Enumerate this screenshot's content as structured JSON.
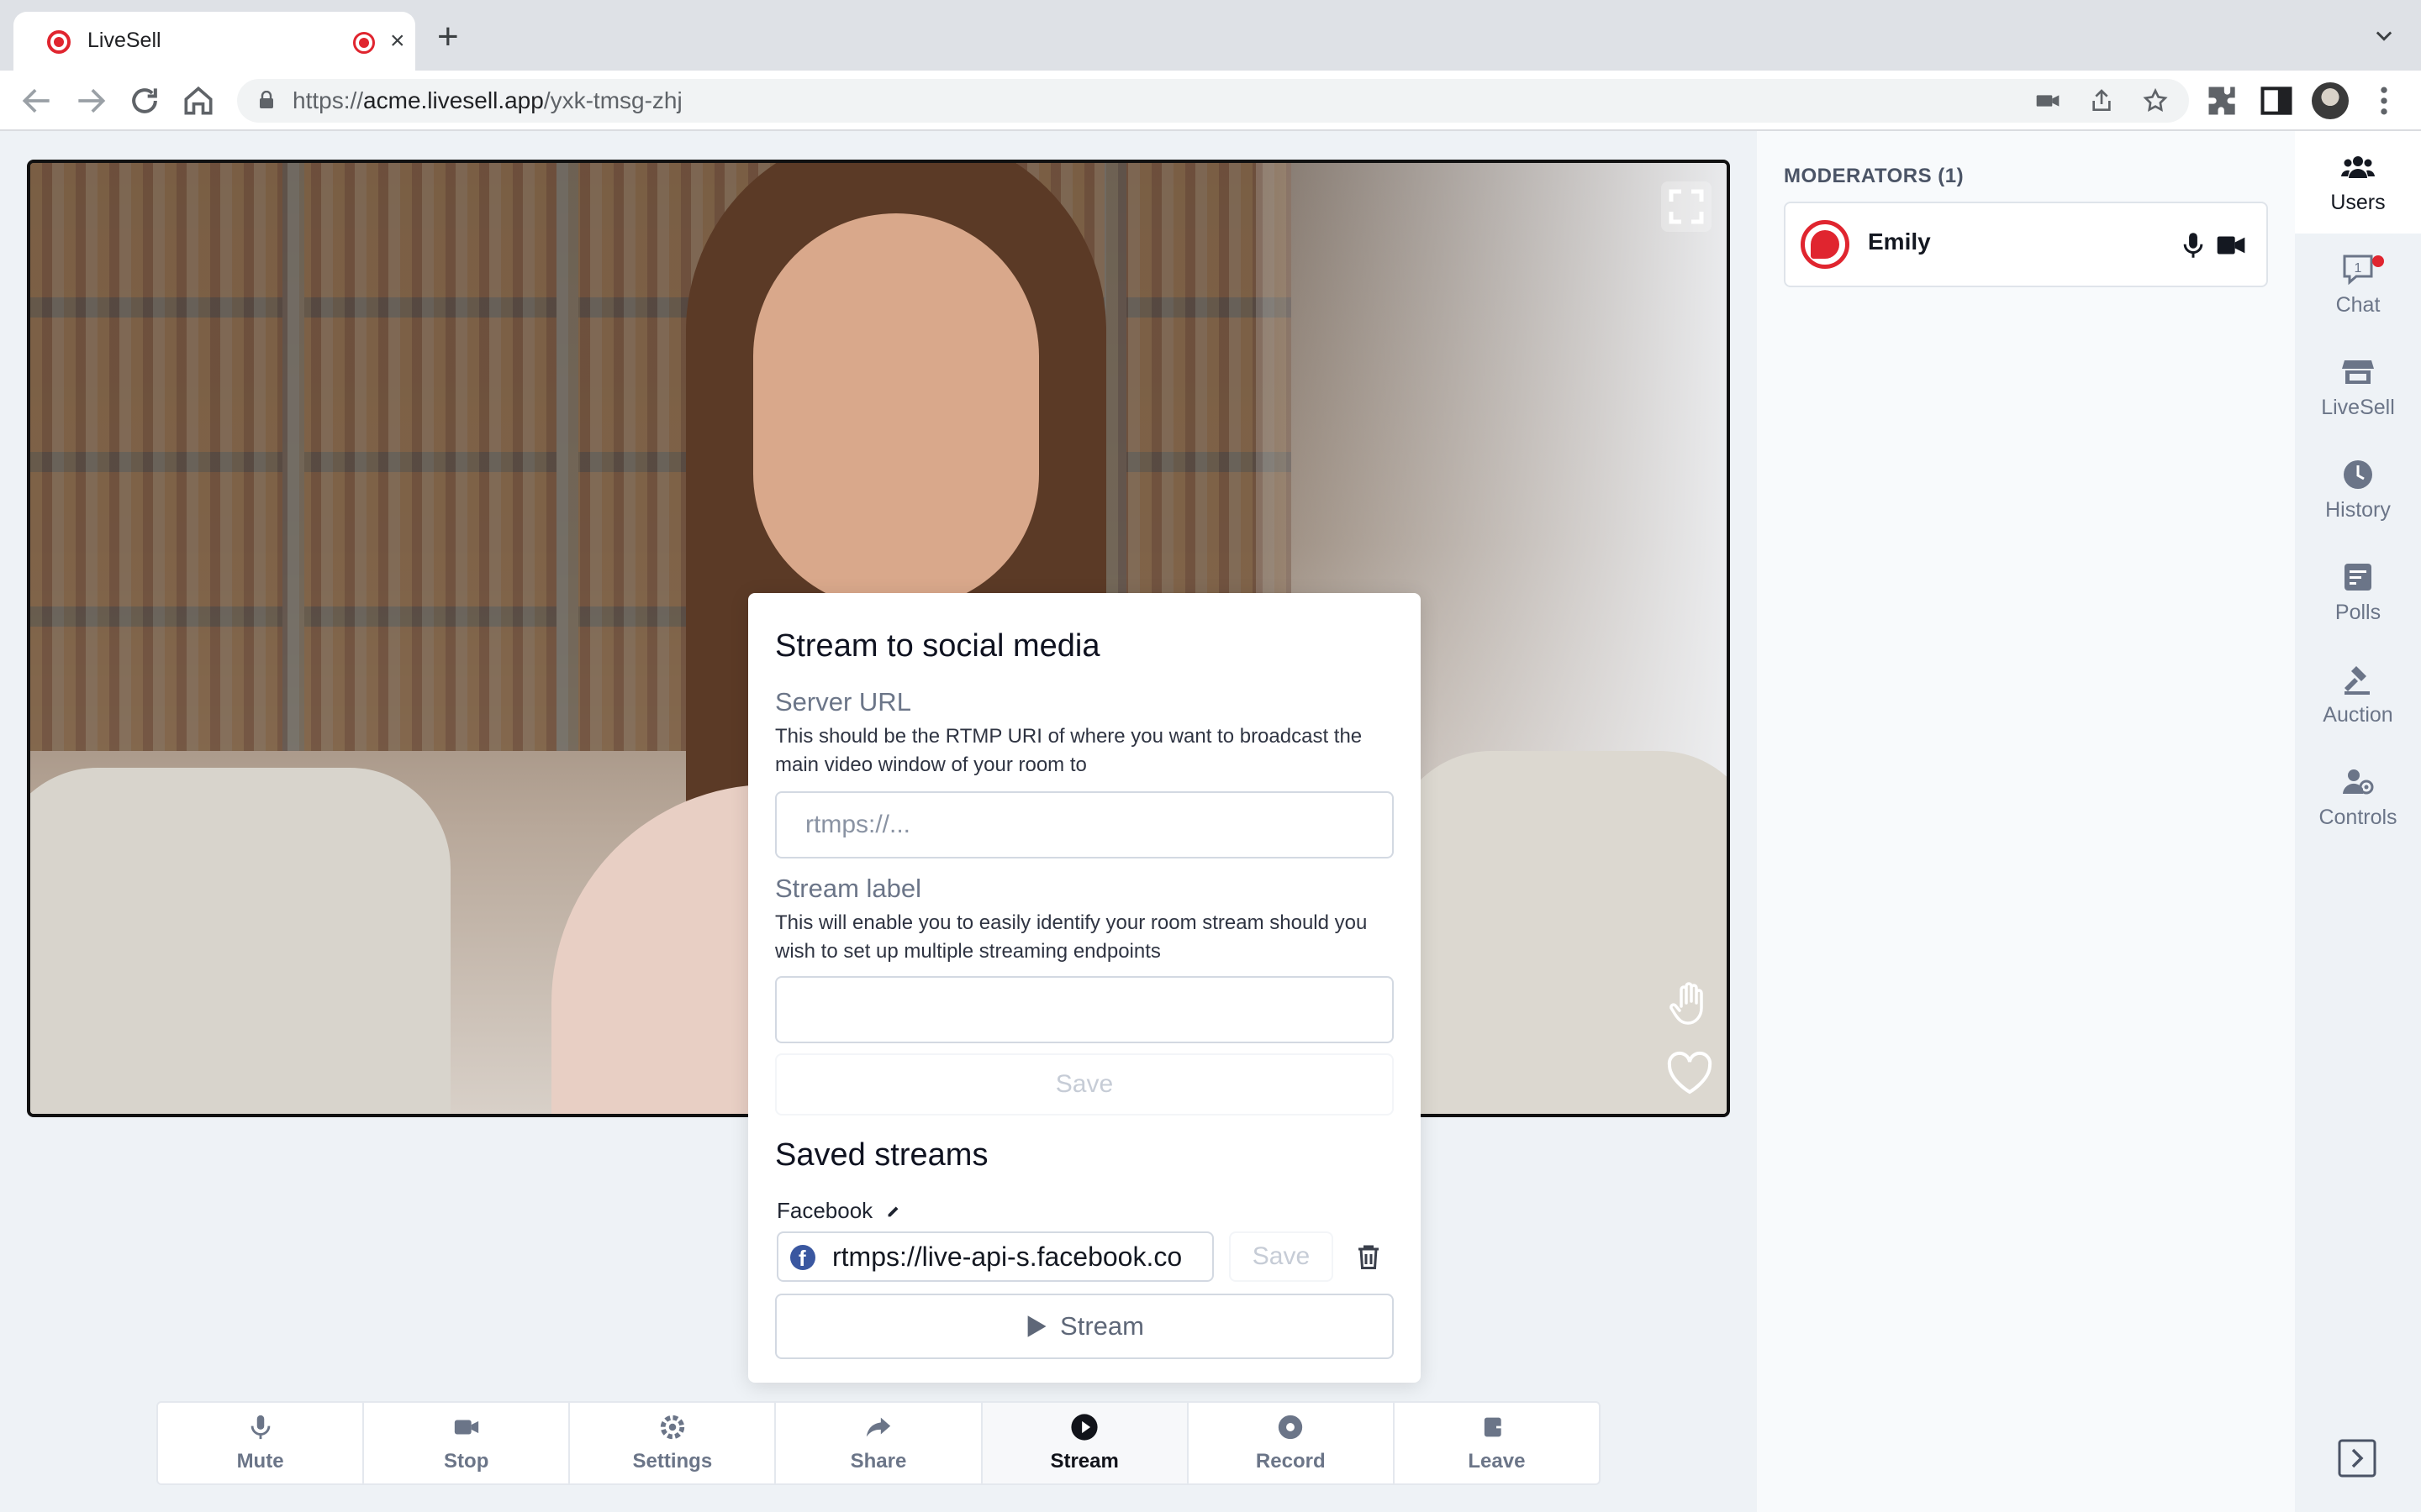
{
  "browser": {
    "tab_title": "LiveSell",
    "tab_close": "×",
    "new_tab": "+",
    "url_scheme": "https://",
    "url_host": "acme.livesell.app",
    "url_path": "/yxk-tmsg-zhj"
  },
  "modal": {
    "title": "Stream to social media",
    "server_url_label": "Server URL",
    "server_url_help": "This should be the RTMP URI of where you want to broadcast the main video window of your room to",
    "server_url_placeholder": "rtmps://...",
    "stream_label_label": "Stream label",
    "stream_label_help": "This will enable you to easily identify your room stream should you wish to set up multiple streaming endpoints",
    "stream_label_value": "",
    "save_label": "Save",
    "saved_title": "Saved streams",
    "saved_streams": [
      {
        "label": "Facebook",
        "url": "rtmps://live-api-s.facebook.co",
        "save_label": "Save",
        "stream_label": "Stream"
      }
    ]
  },
  "controls": [
    {
      "label": "Mute",
      "icon": "mic-icon"
    },
    {
      "label": "Stop",
      "icon": "video-camera-icon"
    },
    {
      "label": "Settings",
      "icon": "gear-icon"
    },
    {
      "label": "Share",
      "icon": "share-arrow-icon"
    },
    {
      "label": "Stream",
      "icon": "play-circle-icon",
      "active": true
    },
    {
      "label": "Record",
      "icon": "record-icon"
    },
    {
      "label": "Leave",
      "icon": "leave-icon"
    }
  ],
  "users_panel": {
    "title": "MODERATORS (1)",
    "moderators": [
      {
        "name": "Emily"
      }
    ]
  },
  "rail": [
    {
      "label": "Users",
      "icon": "users-icon",
      "active": true
    },
    {
      "label": "Chat",
      "icon": "chat-icon",
      "badge": "1"
    },
    {
      "label": "LiveSell",
      "icon": "store-icon"
    },
    {
      "label": "History",
      "icon": "clock-icon"
    },
    {
      "label": "Polls",
      "icon": "poll-icon"
    },
    {
      "label": "Auction",
      "icon": "gavel-icon"
    },
    {
      "label": "Controls",
      "icon": "user-controls-icon"
    }
  ],
  "colors": {
    "brand_red": "#e0252f",
    "app_bg": "#eef2f6",
    "muted_text": "#6b7588"
  }
}
